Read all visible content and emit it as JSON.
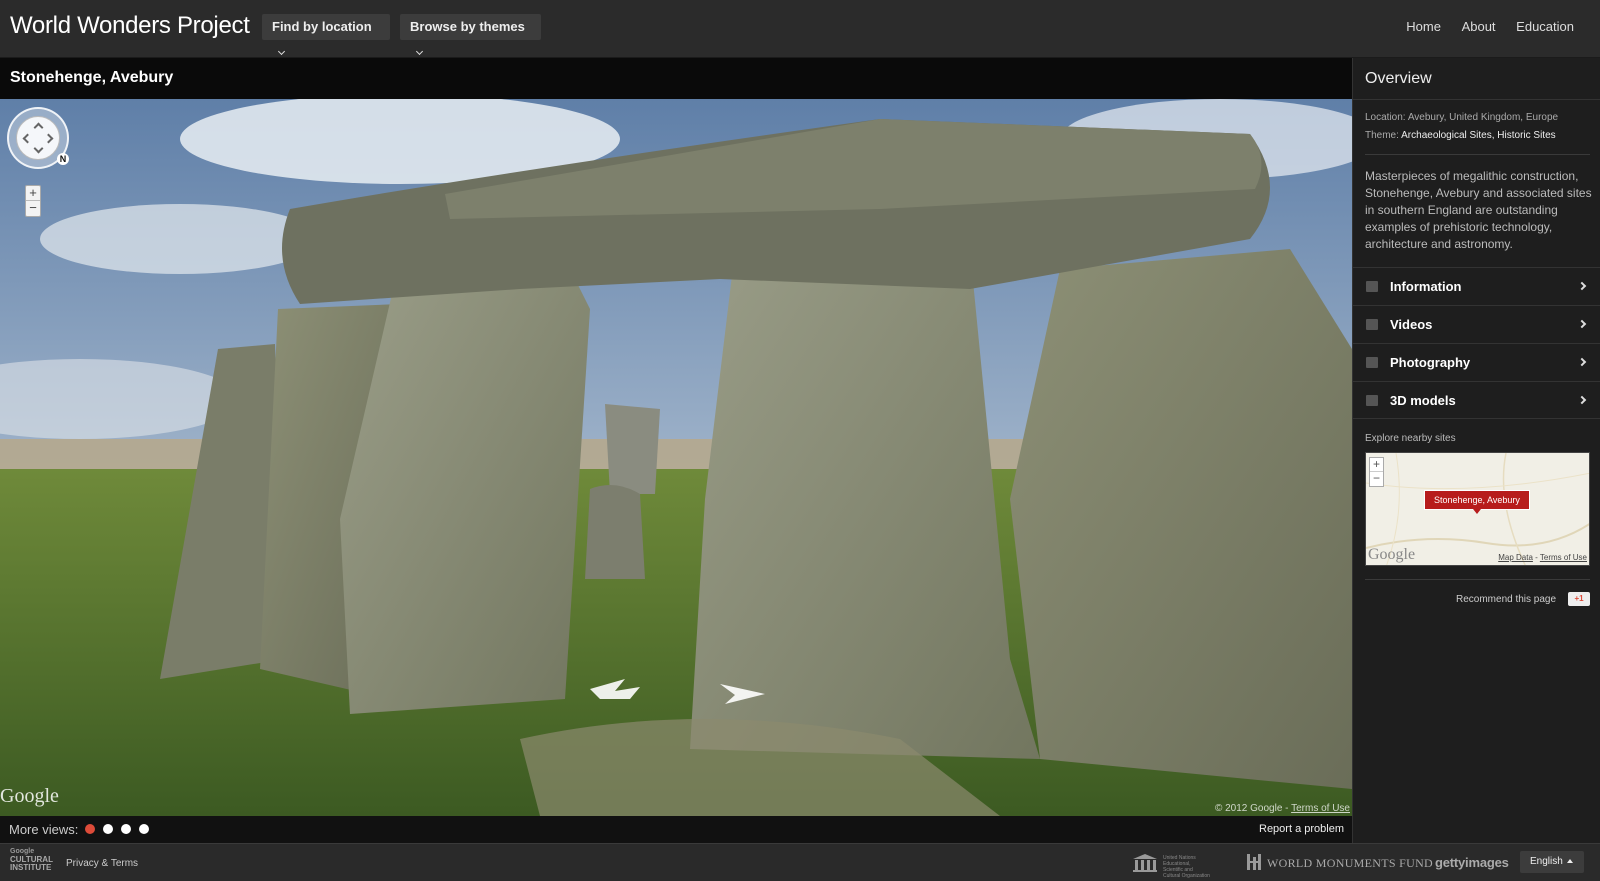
{
  "header": {
    "brand": "World Wonders Project",
    "find_by_location": "Find by location",
    "browse_by_themes": "Browse by themes",
    "nav": [
      "Home",
      "About",
      "Education"
    ]
  },
  "place": {
    "title": "Stonehenge, Avebury"
  },
  "pano": {
    "google_logo": "Google",
    "copyright": "© 2012 Google - ",
    "terms": "Terms of Use",
    "compass_letter": "N",
    "zoom_in": "+",
    "zoom_out": "−"
  },
  "more_views": {
    "label": "More views:",
    "count": 4,
    "active_index": 0,
    "report": "Report a problem"
  },
  "sidebar": {
    "overview": "Overview",
    "location_label": "Location: ",
    "location_value": "Avebury, United Kingdom, Europe",
    "theme_label": "Theme: ",
    "theme_value": "Archaeological Sites, Historic Sites",
    "description": "Masterpieces of megalithic construction, Stonehenge, Avebury and associated sites in southern England are outstanding examples of prehistoric technology, architecture and astronomy.",
    "menu": [
      {
        "label": "Information",
        "icon": "list-icon"
      },
      {
        "label": "Videos",
        "icon": "film-icon"
      },
      {
        "label": "Photography",
        "icon": "camera-icon"
      },
      {
        "label": "3D models",
        "icon": "cube-icon"
      }
    ],
    "explore": "Explore nearby sites",
    "map_pin": "Stonehenge, Avebury",
    "map_google": "Google",
    "map_data": "Map Data",
    "map_dash": " - ",
    "map_terms": "Terms of Use",
    "recommend": "Recommend this page",
    "gplus": "+1"
  },
  "footer": {
    "gci_line1": "Google",
    "gci_line2": "CULTURAL",
    "gci_line3": "INSTITUTE",
    "privacy": "Privacy & Terms",
    "unesco_text": "United Nations Educational, Scientific and Cultural Organization",
    "wmf": "WORLD MONUMENTS FUND",
    "getty": "gettyimages",
    "language": "English"
  },
  "colors": {
    "accent_red": "#dd4b39",
    "pin_red": "#b71c1c"
  }
}
